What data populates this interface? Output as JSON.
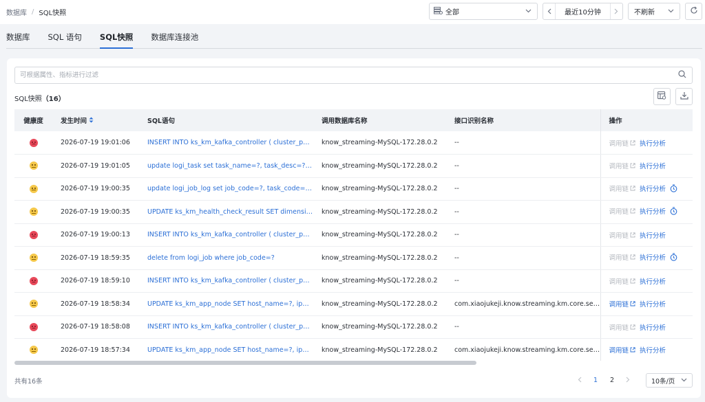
{
  "breadcrumb": {
    "parent": "数据库",
    "separator": "/",
    "current": "SQL快照"
  },
  "top_controls": {
    "database_select": "全部",
    "time_range": "最近10分钟",
    "refresh": "不刷新"
  },
  "tabs": [
    {
      "label": "数据库",
      "active": false
    },
    {
      "label": "SQL 语句",
      "active": false
    },
    {
      "label": "SQL快照",
      "active": true
    },
    {
      "label": "数据库连接池",
      "active": false
    }
  ],
  "filter": {
    "placeholder": "可根据属性、指标进行过滤"
  },
  "section": {
    "title": "SQL快照",
    "count": "（16）"
  },
  "table": {
    "headers": {
      "health": "健康度",
      "time": "发生时间",
      "sql": "SQL语句",
      "db": "调用数据库名称",
      "api": "接口识别名称",
      "op": "操作"
    },
    "op_labels": {
      "trace": "调用链",
      "analyze": "执行分析"
    },
    "rows": [
      {
        "health": "bad",
        "time": "2026-07-19 19:01:06",
        "sql": "INSERT INTO ks_km_kafka_controller ( cluster_phy_id, broker_id, ...",
        "db": "know_streaming-MySQL-172.28.0.2",
        "api": "--",
        "trace_enabled": false,
        "timer": false
      },
      {
        "health": "mid",
        "time": "2026-07-19 19:01:05",
        "sql": "update logi_task set task_name=?, task_desc=?, ...",
        "db": "know_streaming-MySQL-172.28.0.2",
        "api": "--",
        "trace_enabled": false,
        "timer": false
      },
      {
        "health": "mid",
        "time": "2026-07-19 19:00:35",
        "sql": "update logi_job_log set job_code=?, task_code=?, ...",
        "db": "know_streaming-MySQL-172.28.0.2",
        "api": "--",
        "trace_enabled": false,
        "timer": true
      },
      {
        "health": "mid",
        "time": "2026-07-19 19:00:35",
        "sql": "UPDATE ks_km_health_check_result SET dimension=?, ...",
        "db": "know_streaming-MySQL-172.28.0.2",
        "api": "--",
        "trace_enabled": false,
        "timer": true
      },
      {
        "health": "bad",
        "time": "2026-07-19 19:00:13",
        "sql": "INSERT INTO ks_km_kafka_controller ( cluster_phy_id, broker_id, ...",
        "db": "know_streaming-MySQL-172.28.0.2",
        "api": "--",
        "trace_enabled": false,
        "timer": false
      },
      {
        "health": "mid",
        "time": "2026-07-19 18:59:35",
        "sql": "delete from logi_job where job_code=?",
        "db": "know_streaming-MySQL-172.28.0.2",
        "api": "--",
        "trace_enabled": false,
        "timer": true
      },
      {
        "health": "bad",
        "time": "2026-07-19 18:59:10",
        "sql": "INSERT INTO ks_km_kafka_controller ( cluster_phy_id, broker_id, ...",
        "db": "know_streaming-MySQL-172.28.0.2",
        "api": "--",
        "trace_enabled": false,
        "timer": false
      },
      {
        "health": "mid",
        "time": "2026-07-19 18:58:34",
        "sql": "UPDATE ks_km_app_node SET host_name=?, ip=?, ...",
        "db": "know_streaming-MySQL-172.28.0.2",
        "api": "com.xiaojukeji.know.streaming.km.core.service.km.impl",
        "trace_enabled": true,
        "timer": false
      },
      {
        "health": "bad",
        "time": "2026-07-19 18:58:08",
        "sql": "INSERT INTO ks_km_kafka_controller ( cluster_phy_id, broker_id, ...",
        "db": "know_streaming-MySQL-172.28.0.2",
        "api": "--",
        "trace_enabled": false,
        "timer": false
      },
      {
        "health": "mid",
        "time": "2026-07-19 18:57:34",
        "sql": "UPDATE ks_km_app_node SET host_name=?, ip=?, ...",
        "db": "know_streaming-MySQL-172.28.0.2",
        "api": "com.xiaojukeji.know.streaming.km.core.service.km.impl",
        "trace_enabled": true,
        "timer": false
      }
    ]
  },
  "footer": {
    "total": "共有16条",
    "pages": [
      "1",
      "2"
    ],
    "current_page": "1",
    "page_size": "10条/页"
  },
  "colors": {
    "accent": "#2b6fd6",
    "bad": "#e8495a",
    "mid": "#f5c84a"
  }
}
